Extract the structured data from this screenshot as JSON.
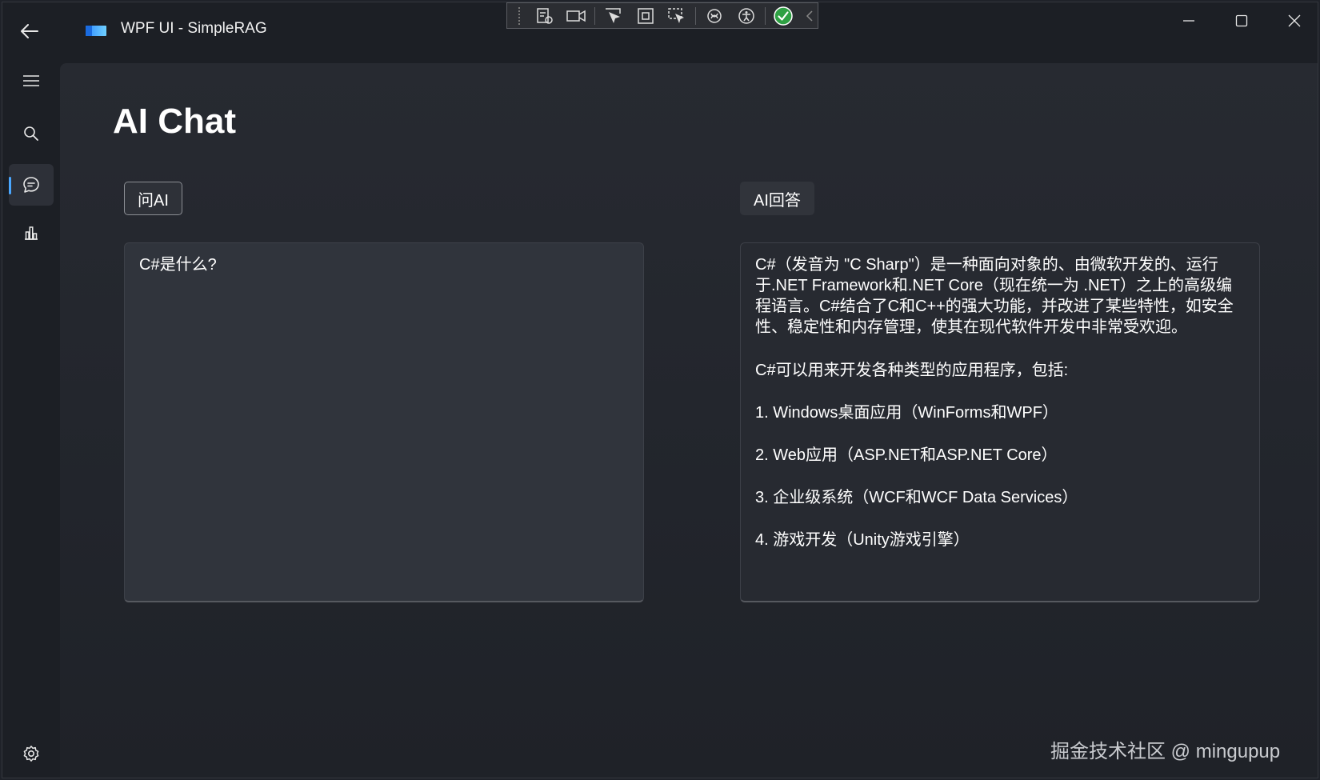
{
  "window": {
    "title": "WPF UI - SimpleRAG"
  },
  "page": {
    "title": "AI Chat"
  },
  "chat": {
    "ask_button_label": "问AI",
    "answer_button_label": "AI回答",
    "question_text": "C#是什么?",
    "answer_paragraphs": [
      "C#（发音为 \"C Sharp\"）是一种面向对象的、由微软开发的、运行于.NET Framework和.NET Core（现在统一为 .NET）之上的高级编程语言。C#结合了C和C++的强大功能，并改进了某些特性，如安全性、稳定性和内存管理，使其在现代软件开发中非常受欢迎。",
      "C#可以用来开发各种类型的应用程序，包括:",
      "1. Windows桌面应用（WinForms和WPF）",
      "2. Web应用（ASP.NET和ASP.NET Core）",
      "3. 企业级系统（WCF和WCF Data Services）",
      "4. 游戏开发（Unity游戏引擎）"
    ]
  },
  "watermark": "掘金技术社区 @ mingupup",
  "icons": {
    "back": "back-arrow-icon",
    "app": "app-logo-icon",
    "menu": "hamburger-menu-icon",
    "search": "search-icon",
    "chat": "chat-bubble-icon",
    "chart": "bar-chart-icon",
    "settings": "gear-icon"
  },
  "colors": {
    "accent": "#4aa7ff",
    "background": "#1c1f25",
    "panel": "#272a31"
  }
}
